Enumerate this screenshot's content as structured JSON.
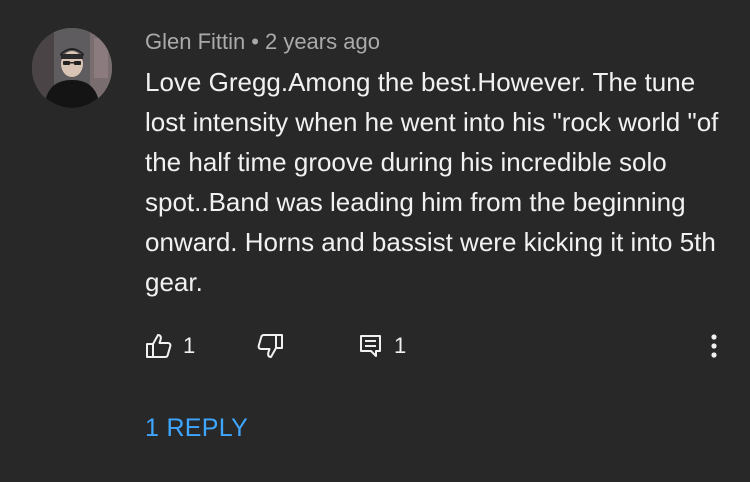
{
  "comment": {
    "author": "Glen Fittin",
    "separator": "•",
    "timestamp": "2 years ago",
    "text": "Love Gregg.Among the best.However. The tune lost intensity when he went into his \"rock world \"of the half time groove during his incredible solo spot..Band was leading him from the beginning onward. Horns and bassist were kicking it into 5th gear.",
    "like_count": "1",
    "reply_count": "1",
    "replies_link": "1 REPLY"
  },
  "icons": {
    "like": "thumbs-up-icon",
    "dislike": "thumbs-down-icon",
    "reply": "comment-icon",
    "more": "more-vertical-icon"
  },
  "colors": {
    "background": "#282828",
    "text": "#f1f1f1",
    "secondary_text": "#aaaaaa",
    "link": "#3ea6ff"
  }
}
